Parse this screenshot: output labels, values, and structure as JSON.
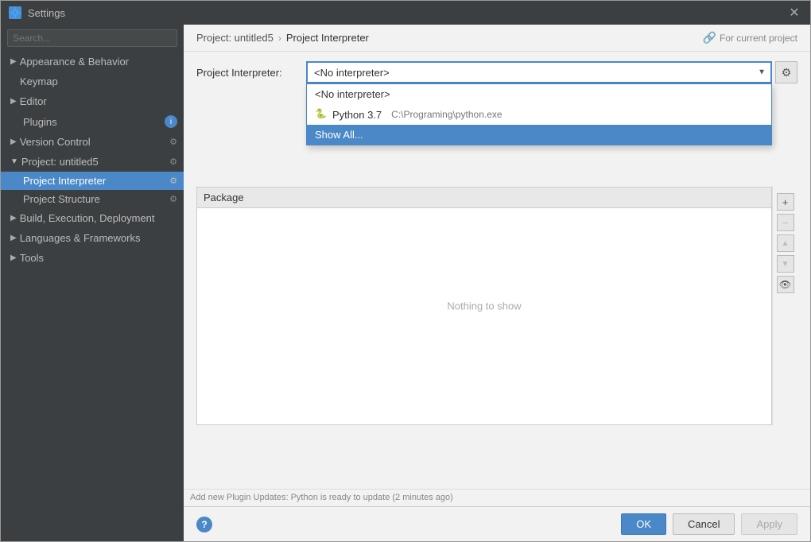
{
  "window": {
    "title": "Settings",
    "icon": "S"
  },
  "search": {
    "placeholder": "Search...",
    "value": ""
  },
  "sidebar": {
    "items": [
      {
        "id": "appearance",
        "label": "Appearance & Behavior",
        "indent": 0,
        "expanded": false,
        "has_arrow": true,
        "badge": ""
      },
      {
        "id": "keymap",
        "label": "Keymap",
        "indent": 1,
        "expanded": false,
        "has_arrow": false,
        "badge": ""
      },
      {
        "id": "editor",
        "label": "Editor",
        "indent": 0,
        "expanded": false,
        "has_arrow": true,
        "badge": ""
      },
      {
        "id": "plugins",
        "label": "Plugins",
        "indent": 0,
        "expanded": false,
        "has_arrow": false,
        "badge": "i"
      },
      {
        "id": "version-control",
        "label": "Version Control",
        "indent": 0,
        "expanded": false,
        "has_arrow": true,
        "badge": ""
      },
      {
        "id": "project-untitled5",
        "label": "Project: untitled5",
        "indent": 0,
        "expanded": true,
        "has_arrow": true,
        "badge": ""
      },
      {
        "id": "project-interpreter",
        "label": "Project Interpreter",
        "indent": 1,
        "expanded": false,
        "has_arrow": false,
        "badge": "",
        "active": true
      },
      {
        "id": "project-structure",
        "label": "Project Structure",
        "indent": 1,
        "expanded": false,
        "has_arrow": false,
        "badge": ""
      },
      {
        "id": "build-execution",
        "label": "Build, Execution, Deployment",
        "indent": 0,
        "expanded": false,
        "has_arrow": true,
        "badge": ""
      },
      {
        "id": "languages-frameworks",
        "label": "Languages & Frameworks",
        "indent": 0,
        "expanded": false,
        "has_arrow": true,
        "badge": ""
      },
      {
        "id": "tools",
        "label": "Tools",
        "indent": 0,
        "expanded": false,
        "has_arrow": true,
        "badge": ""
      }
    ]
  },
  "breadcrumb": {
    "project": "Project: untitled5",
    "separator": "›",
    "current": "Project Interpreter",
    "for_current": "For current project"
  },
  "interpreter": {
    "label": "Project Interpreter:",
    "selected": "<No interpreter>",
    "options": [
      {
        "id": "no-interpreter",
        "label": "<No interpreter>",
        "icon": ""
      },
      {
        "id": "python37",
        "label": "Python 3.7",
        "path": "C:\\Programing\\python.exe",
        "icon": "🐍"
      },
      {
        "id": "show-all",
        "label": "Show All...",
        "icon": "",
        "highlighted": true
      }
    ]
  },
  "table": {
    "column": "Package",
    "empty_text": "Nothing to show"
  },
  "buttons": {
    "add": "+",
    "remove": "−",
    "up": "▲",
    "down": "▼",
    "eye": "👁"
  },
  "footer": {
    "ok": "OK",
    "cancel": "Cancel",
    "apply": "Apply"
  },
  "status_bar": {
    "text": "Add new Plugin Updates: Python is ready to update (2 minutes ago)"
  }
}
